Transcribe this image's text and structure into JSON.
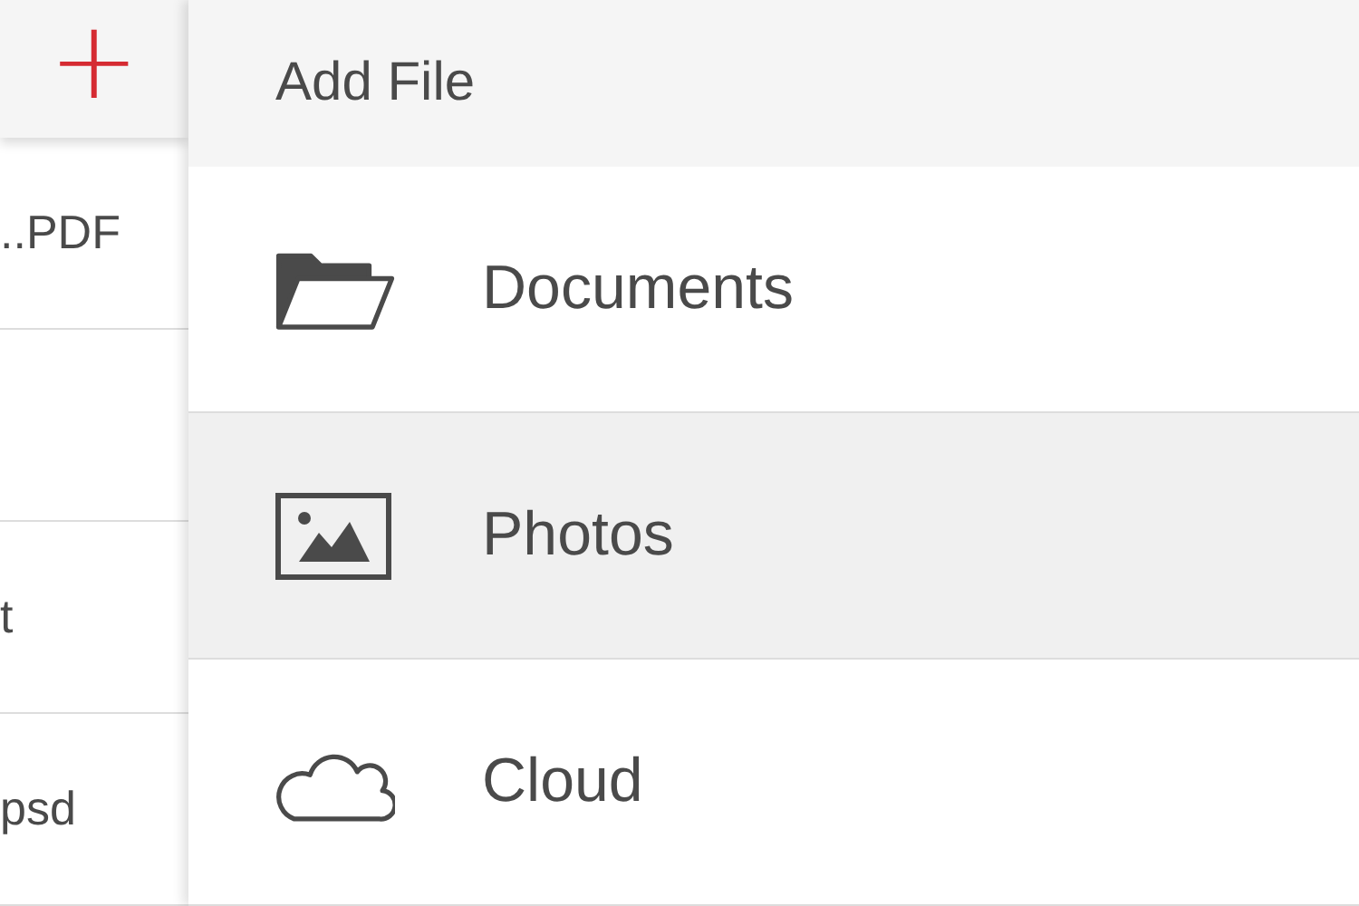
{
  "file_list": {
    "add_button": "+",
    "rows": [
      {
        "name": "..PDF"
      },
      {},
      {
        "name": "t"
      },
      {
        "name": "psd"
      }
    ]
  },
  "add_file_menu": {
    "title": "Add File",
    "items": [
      {
        "label": "Documents",
        "kind": "folder",
        "selected": false
      },
      {
        "label": "Photos",
        "kind": "image",
        "selected": true
      },
      {
        "label": "Cloud",
        "kind": "cloud",
        "selected": false
      }
    ]
  }
}
